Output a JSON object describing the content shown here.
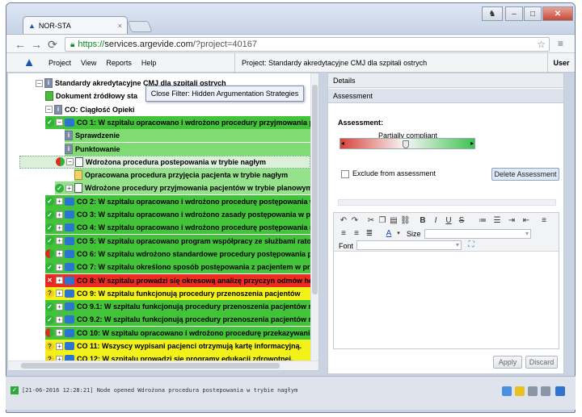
{
  "browser": {
    "tab_title": "NOR-STA",
    "tab_close": "×",
    "url_scheme": "https://",
    "url_host": "services.argevide.com",
    "url_path": "/?project=40167",
    "user_glyph": "♞"
  },
  "menu": {
    "items": [
      "Project",
      "View",
      "Reports",
      "Help"
    ],
    "project_title": "Project: Standardy akredytacyjne CMJ dla szpitali ostrych",
    "user_label": "User"
  },
  "tree": {
    "filter_popup": "Close Filter: Hidden Argumentation Strategies",
    "rows": [
      {
        "text": "Standardy akredytacyjne CMJ dla szpitali ostrych",
        "indent": 1,
        "status": "",
        "expander": "−",
        "icon": "info",
        "bg": ""
      },
      {
        "text": "Dokument źródłowy sta",
        "indent": 2,
        "status": "",
        "expander": "",
        "icon": "green-doc",
        "bg": ""
      },
      {
        "text": "CO: Ciągłość Opieki",
        "indent": 2,
        "status": "",
        "expander": "−",
        "icon": "info",
        "bg": ""
      },
      {
        "text": "CO 1: W szpitalu opracowano i wdrożono procedury przyjmowania pa",
        "indent": 3,
        "status": "green",
        "expander": "−",
        "icon": "bubble",
        "bg": "#43c33a"
      },
      {
        "text": "Sprawdzenie",
        "indent": 4,
        "status": "",
        "expander": "",
        "icon": "info",
        "bg": "#7fdc72"
      },
      {
        "text": "Punktowanie",
        "indent": 4,
        "status": "",
        "expander": "",
        "icon": "info",
        "bg": "#7fdc72"
      },
      {
        "text": "Wdrożona procedura postepowania w trybie nagłym",
        "indent": 4,
        "status": "half",
        "expander": "−",
        "icon": "doc",
        "bg": "#dcefd8"
      },
      {
        "text": "Opracowana procedura przyjęcia pacjenta w trybie nagłym",
        "indent": 5,
        "status": "",
        "expander": "",
        "icon": "people",
        "bg": "#96e28c"
      },
      {
        "text": "Wdrożone procedury przyjmowania pacjentów w trybie planowym",
        "indent": 4,
        "status": "green",
        "expander": "+",
        "icon": "doc",
        "bg": "#96e28c"
      },
      {
        "text": "CO 2: W szpitalu opracowano i wdrożono procedurę postępowania w",
        "indent": 3,
        "status": "green",
        "expander": "+",
        "icon": "bubble",
        "bg": "#43c33a"
      },
      {
        "text": "CO 3: W szpitalu opracowano i wdrożono zasady postępowania w prz",
        "indent": 3,
        "status": "green",
        "expander": "+",
        "icon": "bubble",
        "bg": "#43c33a"
      },
      {
        "text": "CO 4: W szpitalu opracowano i wdrożono procedurę postępowania na",
        "indent": 3,
        "status": "green",
        "expander": "+",
        "icon": "bubble",
        "bg": "#43c33a"
      },
      {
        "text": "CO 5: W szpitalu opracowano program współpracy ze służbami ratow",
        "indent": 3,
        "status": "green",
        "expander": "+",
        "icon": "bubble",
        "bg": "#43c33a"
      },
      {
        "text": "CO 6: W szpitalu wdrożono standardowe procedury postępowania prz",
        "indent": 3,
        "status": "half",
        "expander": "+",
        "icon": "bubble",
        "bg": "#43c33a"
      },
      {
        "text": "CO 7: W szpitalu określono sposób postępowania z pacjentem w przy",
        "indent": 3,
        "status": "green",
        "expander": "+",
        "icon": "bubble",
        "bg": "#43c33a"
      },
      {
        "text": "CO 8: W szpitalu prowadzi się okresową analizę przyczyn odmów hos",
        "indent": 3,
        "status": "red",
        "expander": "+",
        "icon": "bubble",
        "bg": "#ee2b22"
      },
      {
        "text": "CO 9: W szpitalu funkcjonują procedury przenoszenia pacjentów",
        "indent": 3,
        "status": "yellow",
        "expander": "+",
        "icon": "bubble",
        "bg": "#f2f21a"
      },
      {
        "text": "CO 9.1: W szpitalu funkcjonują procedury przenoszenia pacjentów na",
        "indent": 3,
        "status": "green",
        "expander": "+",
        "icon": "bubble",
        "bg": "#43c33a"
      },
      {
        "text": "CO 9.2: W szpitalu funkcjonują procedury przenoszenia pacjentów mi",
        "indent": 3,
        "status": "green",
        "expander": "+",
        "icon": "bubble",
        "bg": "#43c33a"
      },
      {
        "text": "CO 10: W szpitalu opracowano i wdrożono procedurę przekazywania p",
        "indent": 3,
        "status": "half",
        "expander": "+",
        "icon": "bubble",
        "bg": "#43c33a"
      },
      {
        "text": "CO 11: Wszyscy wypisani pacjenci otrzymują kartę informacyjną.",
        "indent": 3,
        "status": "yellow",
        "expander": "+",
        "icon": "bubble",
        "bg": "#f2f21a"
      },
      {
        "text": "CO 12: W szpitalu prowadzi się programy edukacji zdrowotnej.",
        "indent": 3,
        "status": "yellow",
        "expander": "+",
        "icon": "bubble",
        "bg": "#f2f21a"
      }
    ]
  },
  "details": {
    "header": "Details",
    "sub_header": "Assessment",
    "assessment_label": "Assessment:",
    "assessment_value": "Partially compliant",
    "slider_level": 0.48,
    "exclude_label": "Exclude from assessment",
    "delete_button": "Delete Assessment",
    "size_label": "Size",
    "font_label": "Font",
    "apply_button": "Apply",
    "discard_button": "Discard"
  },
  "status": {
    "log": "[21-06-2016 12:28:21] Node opened Wdrożona procedura postepowania w trybie nagłym"
  },
  "colors": {
    "green": "#43c33a",
    "red": "#ee2b22",
    "yellow": "#f2f21a",
    "accent": "#1a56a8"
  }
}
